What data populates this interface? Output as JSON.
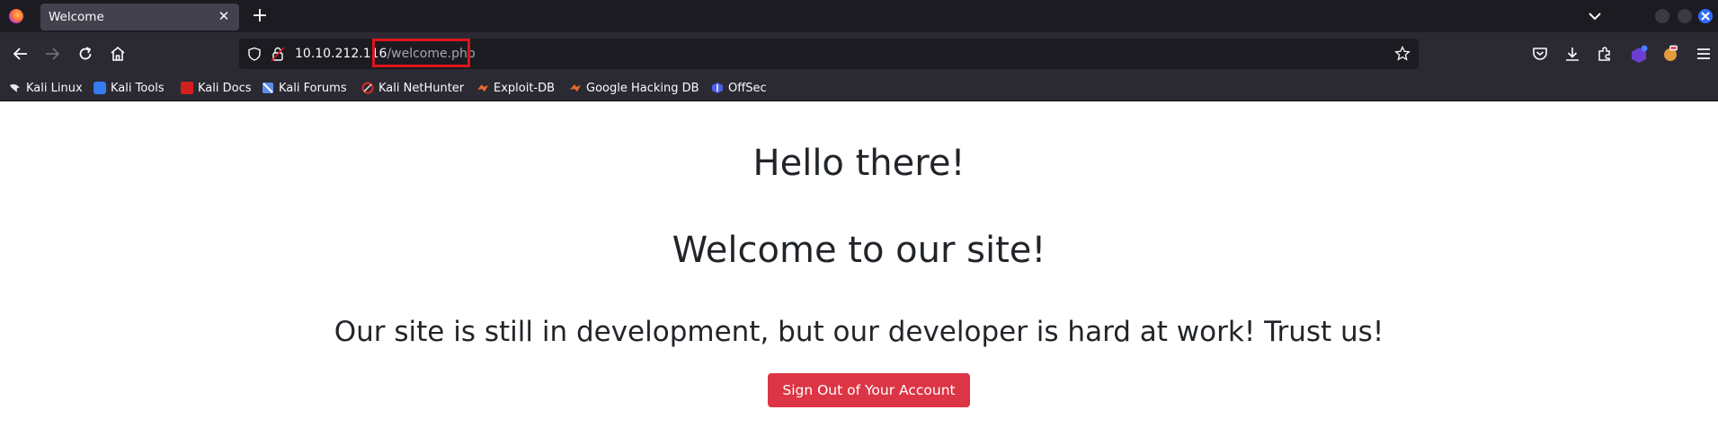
{
  "browser": {
    "tab": {
      "title": "Welcome",
      "close_glyph": "✕"
    },
    "new_tab_glyph": "+",
    "address_bar": {
      "host": "10.10.212.116",
      "path": "/welcome.php"
    },
    "icons": {
      "back": "arrow-left-icon",
      "forward": "arrow-right-icon",
      "reload": "reload-icon",
      "home": "home-icon",
      "shield": "tracking-protection-shield-icon",
      "lock": "insecure-lock-icon",
      "bookmark_star": "star-icon",
      "pocket": "pocket-icon",
      "downloads": "download-icon",
      "extensions": "extensions-icon",
      "menu": "hamburger-menu-icon"
    }
  },
  "bookmarks": [
    {
      "label": "Kali Linux",
      "icon": "kali-dragon-icon",
      "color": "#e8e8ea"
    },
    {
      "label": "Kali Tools",
      "icon": "kali-tools-icon",
      "color": "#367bf0"
    },
    {
      "label": "Kali Docs",
      "icon": "kali-docs-icon",
      "color": "#d21f1f"
    },
    {
      "label": "Kali Forums",
      "icon": "kali-forums-icon",
      "color": "#5b8def"
    },
    {
      "label": "Kali NetHunter",
      "icon": "nethunter-icon",
      "color": "#e0281c"
    },
    {
      "label": "Exploit-DB",
      "icon": "exploit-db-icon",
      "color": "#ec6b2d"
    },
    {
      "label": "Google Hacking DB",
      "icon": "ghdb-icon",
      "color": "#ec6b2d"
    },
    {
      "label": "OffSec",
      "icon": "offsec-icon",
      "color": "#4a60e8"
    }
  ],
  "page": {
    "greeting": "Hello there!",
    "welcome": "Welcome to our site!",
    "message": "Our site is still in development, but our developer is hard at work! Trust us!",
    "signout_label": "Sign Out of Your Account"
  },
  "colors": {
    "signout_button": "#dc3545",
    "highlight_box": "#e0141b",
    "heading_text": "#212529"
  }
}
